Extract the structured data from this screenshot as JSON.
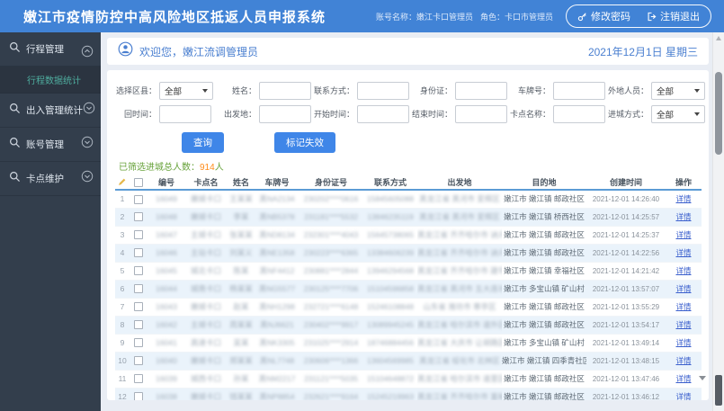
{
  "topbar": {
    "title": "嫩江市疫情防控中高风险地区抵返人员申报系统",
    "account": "账号名称：嫩江卡口管理员",
    "role": "角色：卡口市管理员",
    "change_password": "修改密码",
    "logout": "注销退出"
  },
  "sidebar": {
    "items": [
      {
        "label": "行程管理",
        "expanded": true,
        "children": [
          {
            "label": "行程数据统计",
            "active": true
          }
        ]
      },
      {
        "label": "出入管理统计",
        "expanded": false,
        "children": []
      },
      {
        "label": "账号管理",
        "expanded": false,
        "children": []
      },
      {
        "label": "卡点维护",
        "expanded": false,
        "children": []
      }
    ]
  },
  "welcome": {
    "greeting": "欢迎您，嫩江流调管理员",
    "date": "2021年12月1日 星期三"
  },
  "filters": {
    "fields": [
      {
        "label": "选择区县：",
        "type": "select",
        "value": "全部"
      },
      {
        "label": "姓名：",
        "type": "input",
        "value": ""
      },
      {
        "label": "联系方式：",
        "type": "input",
        "value": ""
      },
      {
        "label": "身份证：",
        "type": "input",
        "value": ""
      },
      {
        "label": "车牌号：",
        "type": "input",
        "value": ""
      },
      {
        "label": "外地人员：",
        "type": "select",
        "value": "全部"
      },
      {
        "label": "回时间：",
        "type": "input",
        "value": ""
      },
      {
        "label": "出发地：",
        "type": "input",
        "value": ""
      },
      {
        "label": "开始时间：",
        "type": "input",
        "value": ""
      },
      {
        "label": "结束时间：",
        "type": "input",
        "value": ""
      },
      {
        "label": "卡点名称：",
        "type": "input",
        "value": ""
      },
      {
        "label": "进城方式：",
        "type": "select",
        "value": "全部"
      }
    ]
  },
  "actions": {
    "query": "查询",
    "mark_invalid": "标记失效"
  },
  "summary": {
    "label": "已筛选进城总人数：",
    "count": "914",
    "unit": "人"
  },
  "table": {
    "columns": [
      "编号",
      "卡点名",
      "姓名",
      "车牌号",
      "身份证号",
      "联系方式",
      "出发地",
      "目的地",
      "创建时间",
      "操作"
    ],
    "detail_label": "详情",
    "rows": [
      {
        "no": "1",
        "num": "16049",
        "checkpoint": "嫩城卡口",
        "name": "王某某",
        "plate": "黑NA2134",
        "idcard": "230202****0616",
        "phone": "15845605088",
        "origin": "黑龙江省 黑河市 爱辉区",
        "destination": "嫩江市 嫩江镇 邮政社区",
        "created": "2021-12-01 14:26:40"
      },
      {
        "no": "2",
        "num": "16048",
        "checkpoint": "嫩城卡口",
        "name": "李某",
        "plate": "黑NB5378",
        "idcard": "231181****5532",
        "phone": "13846235119",
        "origin": "黑龙江省 黑河市 爱辉区",
        "destination": "嫩江市 嫩江镇 桥西社区",
        "created": "2021-12-01 14:25:57"
      },
      {
        "no": "3",
        "num": "16047",
        "checkpoint": "主城卡口",
        "name": "张某某",
        "plate": "黑ND8134",
        "idcard": "232301****4043",
        "phone": "15645738065",
        "origin": "黑龙江省 齐齐哈尔市 讷河市",
        "destination": "嫩江市 嫩江镇 邮政社区",
        "created": "2021-12-01 14:25:37"
      },
      {
        "no": "4",
        "num": "16046",
        "checkpoint": "主站卡口",
        "name": "刘某义",
        "plate": "黑NE1358",
        "idcard": "230223****6365",
        "phone": "13384606239",
        "origin": "黑龙江省 齐齐哈尔市 讷河市",
        "destination": "嫩江市 嫩江镇 邮政社区",
        "created": "2021-12-01 14:22:56"
      },
      {
        "no": "5",
        "num": "16045",
        "checkpoint": "城北卡口",
        "name": "陈某",
        "plate": "黑NF4412",
        "idcard": "230881****2844",
        "phone": "13946294568",
        "origin": "黑龙江省 齐齐哈尔市 建华区",
        "destination": "嫩江市 嫩江镇 幸福社区",
        "created": "2021-12-01 14:21:42"
      },
      {
        "no": "6",
        "num": "16044",
        "checkpoint": "城南卡口",
        "name": "杨某某",
        "plate": "黑NG5577",
        "idcard": "230125****7706",
        "phone": "15104596858",
        "origin": "黑龙江省 黑河市 五大连池市",
        "destination": "嫩江市 多宝山镇 矿山村",
        "created": "2021-12-01 13:57:07"
      },
      {
        "no": "7",
        "num": "16043",
        "checkpoint": "嫩城卡口",
        "name": "赵某",
        "plate": "黑NH1298",
        "idcard": "232721****6148",
        "phone": "15246108848",
        "origin": "山东省 潍坊市 寒亭区",
        "destination": "嫩江市 嫩江镇 邮政社区",
        "created": "2021-12-01 13:55:29"
      },
      {
        "no": "8",
        "num": "16042",
        "checkpoint": "主城卡口",
        "name": "周某某",
        "plate": "黑NJ6621",
        "idcard": "230402****9917",
        "phone": "13089945245",
        "origin": "黑龙江省 哈尔滨市 道外区",
        "destination": "嫩江市 嫩江镇 邮政社区",
        "created": "2021-12-01 13:54:17"
      },
      {
        "no": "9",
        "num": "16041",
        "checkpoint": "高速卡口",
        "name": "吴某",
        "plate": "黑NK3305",
        "idcard": "231025****2914",
        "phone": "18746884456",
        "origin": "黑龙江省 大庆市 让胡路区",
        "destination": "嫩江市 多宝山镇 矿山村",
        "created": "2021-12-01 13:49:14"
      },
      {
        "no": "10",
        "num": "16040",
        "checkpoint": "嫩城卡口",
        "name": "郑某某",
        "plate": "黑NL7748",
        "idcard": "230606****1366",
        "phone": "13604569985",
        "origin": "黑龙江省 绥化市 北林区",
        "destination": "嫩江市 嫩江镇 四季青社区",
        "created": "2021-12-01 13:48:15"
      },
      {
        "no": "11",
        "num": "16039",
        "checkpoint": "城西卡口",
        "name": "孙某",
        "plate": "黑NM2217",
        "idcard": "231121****5035",
        "phone": "15104648872",
        "origin": "黑龙江省 哈尔滨市 道里区",
        "destination": "嫩江市 嫩江镇 邮政社区",
        "created": "2021-12-01 13:47:46"
      },
      {
        "no": "12",
        "num": "16038",
        "checkpoint": "嫩城卡口",
        "name": "钱某某",
        "plate": "黑NP8854",
        "idcard": "232621****9164",
        "phone": "15245219963",
        "origin": "黑龙江省 齐齐哈尔市 富裕县",
        "destination": "嫩江市 嫩江镇 邮政社区",
        "created": "2021-12-01 13:46:12"
      }
    ]
  }
}
